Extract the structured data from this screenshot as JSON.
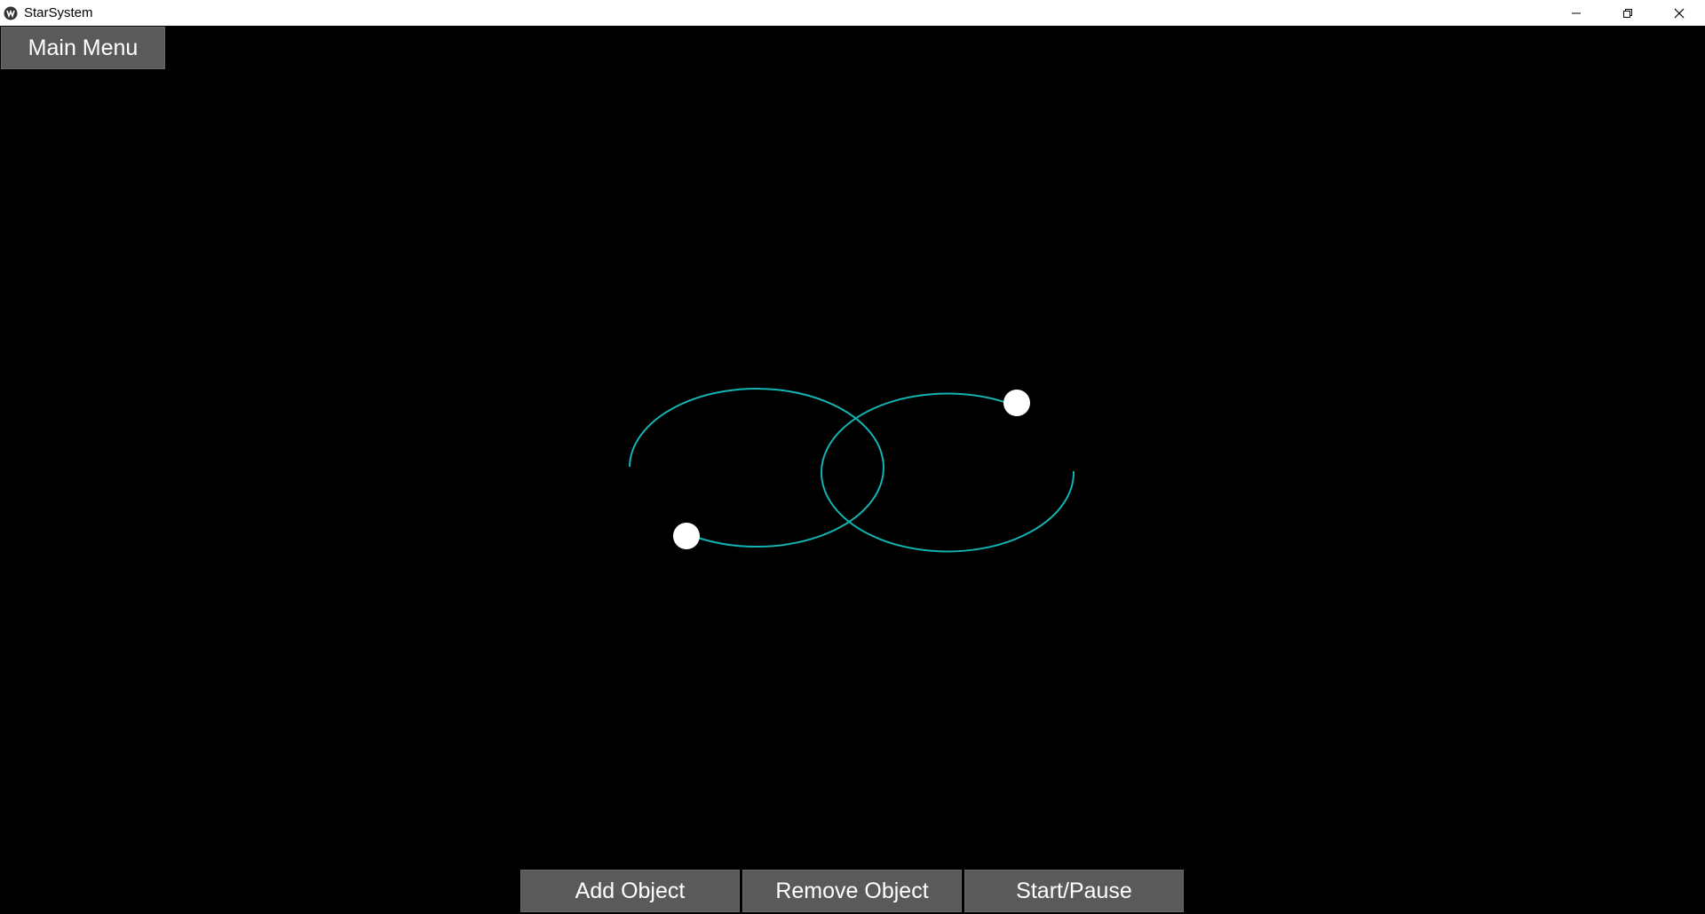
{
  "window": {
    "title": "StarSystem",
    "app_icon": "kivy-logo-icon",
    "controls": [
      "minimize-icon",
      "restore-icon",
      "close-icon"
    ]
  },
  "main_menu": {
    "label": "Main Menu"
  },
  "toolbar": {
    "add_label": "Add Object",
    "remove_label": "Remove Object",
    "start_pause_label": "Start/Pause"
  },
  "colors": {
    "background": "#000000",
    "orbit_trail": "#12b3b3",
    "body": "#ffffff",
    "button_bg": "#5a5a5a",
    "button_text": "#ffffff"
  },
  "simulation": {
    "object_count": 2
  }
}
